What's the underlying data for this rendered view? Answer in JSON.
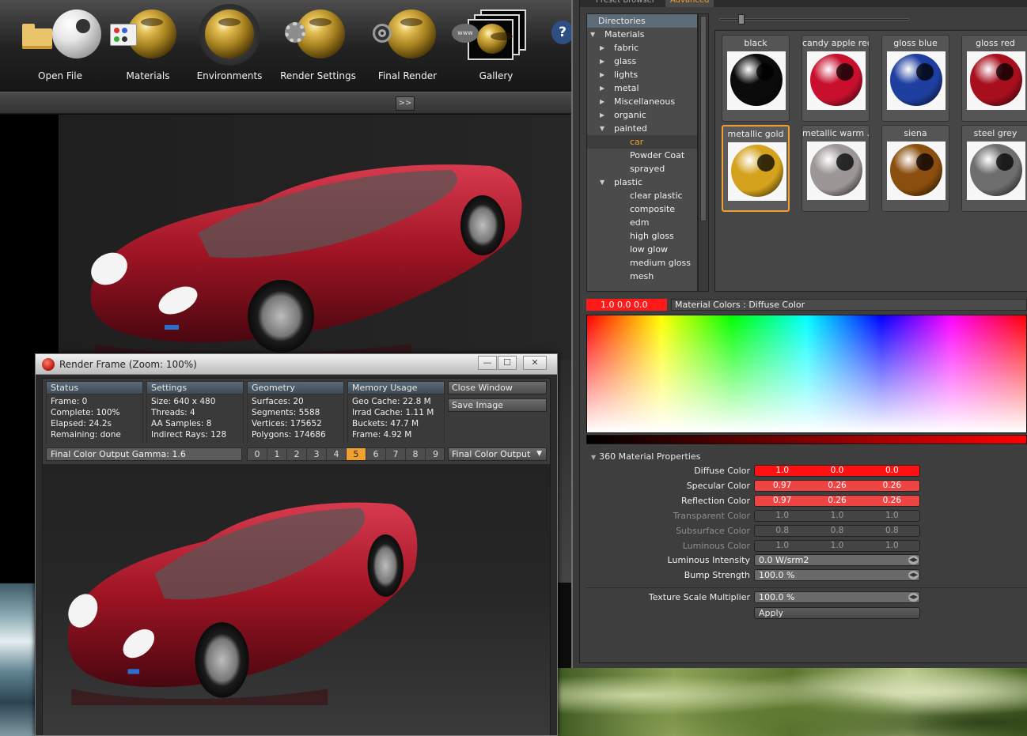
{
  "toolbar": {
    "buttons": [
      {
        "label": "Open File",
        "icon": "open-file-icon"
      },
      {
        "label": "Materials",
        "icon": "materials-icon"
      },
      {
        "label": "Environments",
        "icon": "environments-icon"
      },
      {
        "label": "Render Settings",
        "icon": "render-settings-icon"
      },
      {
        "label": "Final Render",
        "icon": "final-render-icon"
      },
      {
        "label": "Gallery",
        "icon": "gallery-icon"
      }
    ],
    "www_badge": "www",
    "help": "?",
    "expand": ">>"
  },
  "render_window": {
    "title": "Render Frame (Zoom: 100%)",
    "status": {
      "head": "Status",
      "lines": [
        "Frame: 0",
        "Complete: 100%",
        "Elapsed: 24.2s",
        "Remaining: done"
      ]
    },
    "settings": {
      "head": "Settings",
      "lines": [
        "Size: 640 x 480",
        "Threads: 4",
        "AA Samples: 8",
        "Indirect Rays: 128"
      ]
    },
    "geometry": {
      "head": "Geometry",
      "lines": [
        "Surfaces: 20",
        "Segments: 5588",
        "Vertices: 175652",
        "Polygons: 174686"
      ]
    },
    "memory": {
      "head": "Memory Usage",
      "lines": [
        "Geo Cache: 22.8 M",
        "Irrad Cache: 1.11 M",
        "Buckets: 47.7 M",
        "Frame: 4.92 M"
      ]
    },
    "close_button": "Close Window",
    "save_button": "Save Image",
    "gamma": "Final Color Output Gamma: 1.6",
    "buffers": [
      "0",
      "1",
      "2",
      "3",
      "4",
      "5",
      "6",
      "7",
      "8",
      "9"
    ],
    "active_buffer": "5",
    "output": "Final Color Output"
  },
  "right_panel": {
    "tabs": [
      "Preset Browser",
      "Advanced"
    ],
    "active_tab": "Advanced",
    "directories_title": "Directories",
    "tree": [
      {
        "label": "Materials",
        "level": 0,
        "toggle": "▼"
      },
      {
        "label": "fabric",
        "level": 1,
        "toggle": "▶"
      },
      {
        "label": "glass",
        "level": 1,
        "toggle": "▶"
      },
      {
        "label": "lights",
        "level": 1,
        "toggle": "▶"
      },
      {
        "label": "metal",
        "level": 1,
        "toggle": "▶"
      },
      {
        "label": "Miscellaneous",
        "level": 1,
        "toggle": "▶"
      },
      {
        "label": "organic",
        "level": 1,
        "toggle": "▶"
      },
      {
        "label": "painted",
        "level": 1,
        "toggle": "▼"
      },
      {
        "label": "car",
        "level": 2,
        "toggle": "",
        "selected": true
      },
      {
        "label": "Powder Coat",
        "level": 2,
        "toggle": ""
      },
      {
        "label": "sprayed",
        "level": 2,
        "toggle": ""
      },
      {
        "label": "plastic",
        "level": 1,
        "toggle": "▼"
      },
      {
        "label": "clear plastic",
        "level": 2,
        "toggle": ""
      },
      {
        "label": "composite",
        "level": 2,
        "toggle": ""
      },
      {
        "label": "edm",
        "level": 2,
        "toggle": ""
      },
      {
        "label": "high gloss",
        "level": 2,
        "toggle": ""
      },
      {
        "label": "low glow",
        "level": 2,
        "toggle": ""
      },
      {
        "label": "medium gloss",
        "level": 2,
        "toggle": ""
      },
      {
        "label": "mesh",
        "level": 2,
        "toggle": ""
      }
    ],
    "presets": [
      {
        "name": "black",
        "color": "#0b0b0b"
      },
      {
        "name": "candy apple red",
        "color": "#c8102e"
      },
      {
        "name": "gloss blue",
        "color": "#1f3fa0"
      },
      {
        "name": "gloss red",
        "color": "#a80f1e"
      },
      {
        "name": "metallic gold",
        "color": "#d4a21c",
        "selected": true
      },
      {
        "name": "metallic warm ...",
        "color": "#9c9696"
      },
      {
        "name": "siena",
        "color": "#8a4e0e"
      },
      {
        "name": "steel grey",
        "color": "#6e6e6e"
      }
    ],
    "color_readout": "1.0  0.0  0.0",
    "color_caption": "Material Colors : Diffuse Color",
    "properties_title": "360 Material Properties",
    "color_props": [
      {
        "label": "Diffuse Color",
        "values": [
          "1.0",
          "0.0",
          "0.0"
        ],
        "style": "red1"
      },
      {
        "label": "Specular Color",
        "values": [
          "0.97",
          "0.26",
          "0.26"
        ],
        "style": "red2"
      },
      {
        "label": "Reflection Color",
        "values": [
          "0.97",
          "0.26",
          "0.26"
        ],
        "style": "red2"
      },
      {
        "label": "Transparent Color",
        "values": [
          "1.0",
          "1.0",
          "1.0"
        ],
        "style": "dimf"
      },
      {
        "label": "Subsurface Color",
        "values": [
          "0.8",
          "0.8",
          "0.8"
        ],
        "style": "dimf"
      },
      {
        "label": "Luminous Color",
        "values": [
          "1.0",
          "1.0",
          "1.0"
        ],
        "style": "dimf"
      }
    ],
    "luminous_intensity": {
      "label": "Luminous Intensity",
      "value": "0.0 W/srm2"
    },
    "bump_strength": {
      "label": "Bump Strength",
      "value": "100.0 %"
    },
    "texture_scale": {
      "label": "Texture Scale Multiplier",
      "value": "100.0 %"
    },
    "apply": "Apply"
  }
}
